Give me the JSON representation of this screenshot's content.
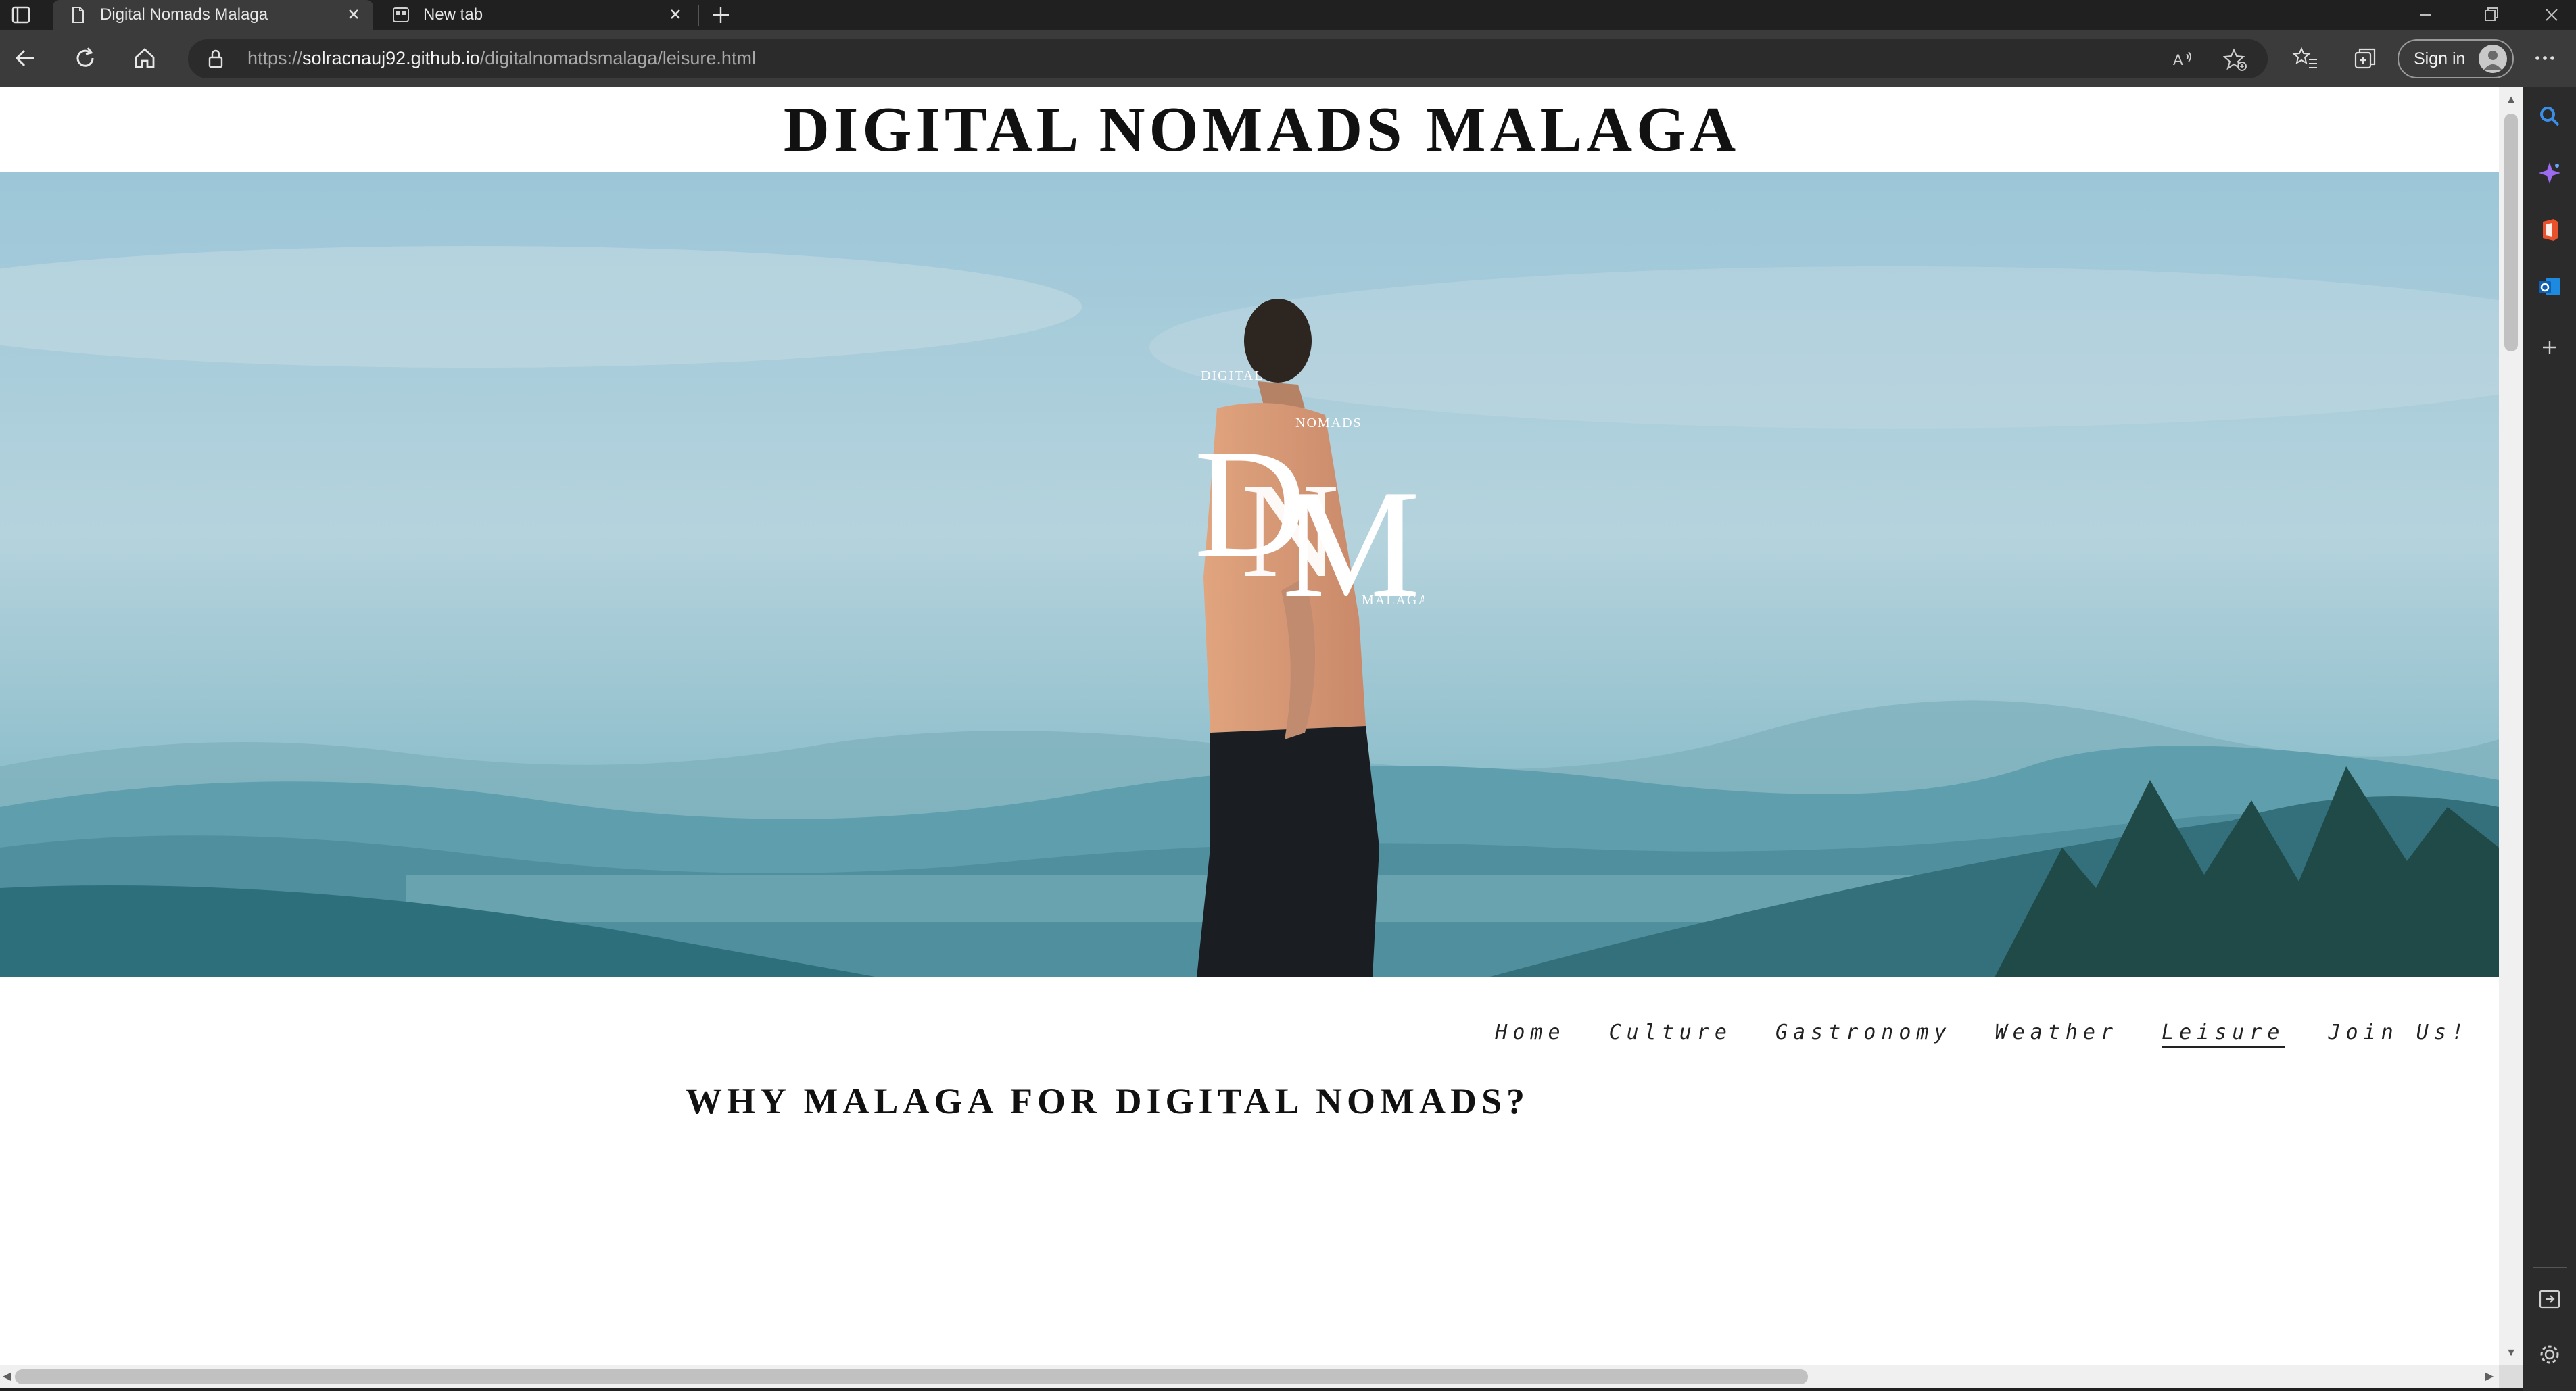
{
  "browser": {
    "tabs": [
      {
        "title": "Digital Nomads Malaga",
        "active": true,
        "icon": "page-icon"
      },
      {
        "title": "New tab",
        "active": false,
        "icon": "newtab-icon"
      }
    ],
    "url": {
      "scheme": "https://",
      "host": "solracnauj92.github.io",
      "path": "/digitalnomadsmalaga/leisure.html"
    },
    "sign_in_label": "Sign in"
  },
  "page": {
    "site_title": "DIGITAL NOMADS MALAGA",
    "logo": {
      "small_top": "DIGITAL",
      "small_mid": "NOMADS",
      "small_bottom": "MALAGA",
      "initials": "DNM"
    },
    "nav": [
      "Home",
      "Culture",
      "Gastronomy",
      "Weather",
      "Leisure",
      "Join Us!"
    ],
    "current_nav": "Leisure",
    "section_title": "WHY MALAGA FOR DIGITAL NOMADS?"
  },
  "colors": {
    "chrome_dark": "#202020",
    "toolbar": "#3b3b3b",
    "sky": "#9cc6d8",
    "mountains": "#3e8896"
  }
}
